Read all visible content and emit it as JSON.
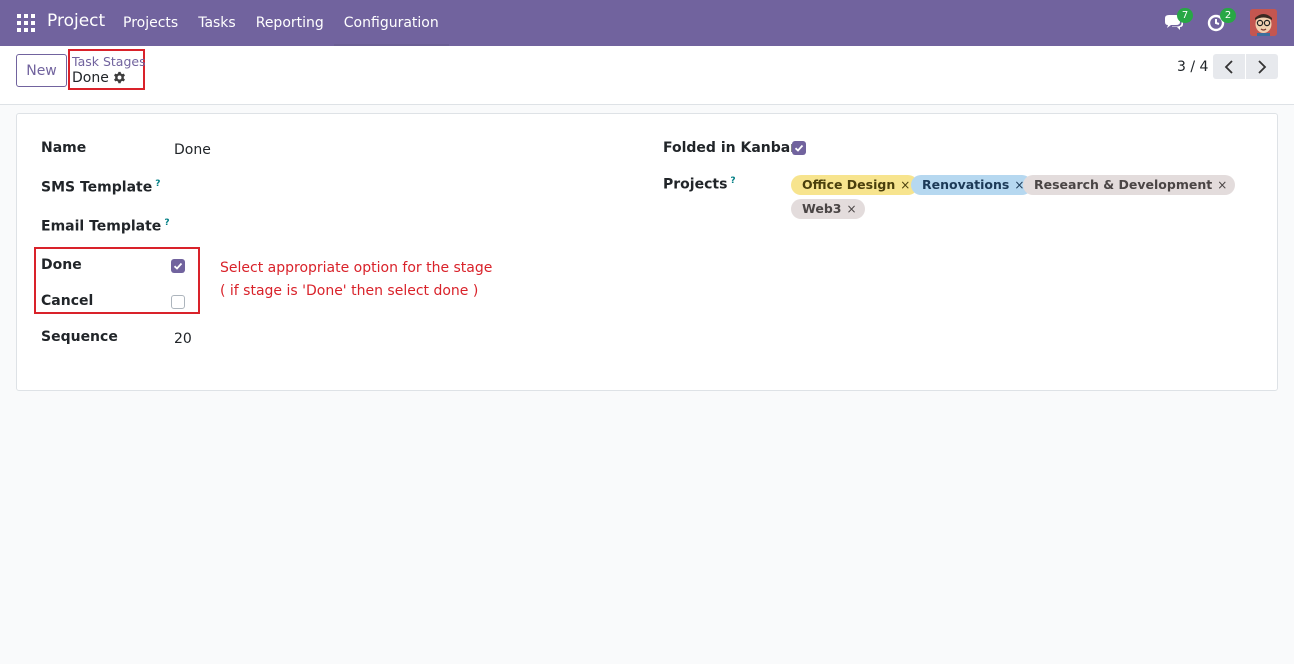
{
  "navbar": {
    "app_name": "Project",
    "menu": [
      "Projects",
      "Tasks",
      "Reporting",
      "Configuration"
    ],
    "chat_badge": "7",
    "activity_badge": "2",
    "accent_color": "#71639e"
  },
  "control_panel": {
    "new_label": "New",
    "breadcrumb_parent": "Task Stages",
    "breadcrumb_current": "Done",
    "pager_value": "3 / 4"
  },
  "form": {
    "name_label": "Name",
    "name_value": "Done",
    "sms_label": "SMS Template",
    "email_label": "Email Template",
    "help_marker": "?",
    "done_label": "Done",
    "done_checked": true,
    "cancel_label": "Cancel",
    "cancel_checked": false,
    "sequence_label": "Sequence",
    "sequence_value": "20",
    "folded_label": "Folded in Kanban",
    "folded_checked": true,
    "projects_label": "Projects",
    "projects": [
      {
        "name": "Office Design",
        "color": "#f7e48e"
      },
      {
        "name": "Renovations",
        "color": "#b6d8f0"
      },
      {
        "name": "Research & Development",
        "color": "#e3dcdc"
      },
      {
        "name": "Web3",
        "color": "#e3dcdc"
      }
    ],
    "tag_remove_glyph": "×"
  },
  "annotation": {
    "line1": "Select appropriate option for the stage",
    "line2": "( if stage is 'Done' then select done )"
  }
}
